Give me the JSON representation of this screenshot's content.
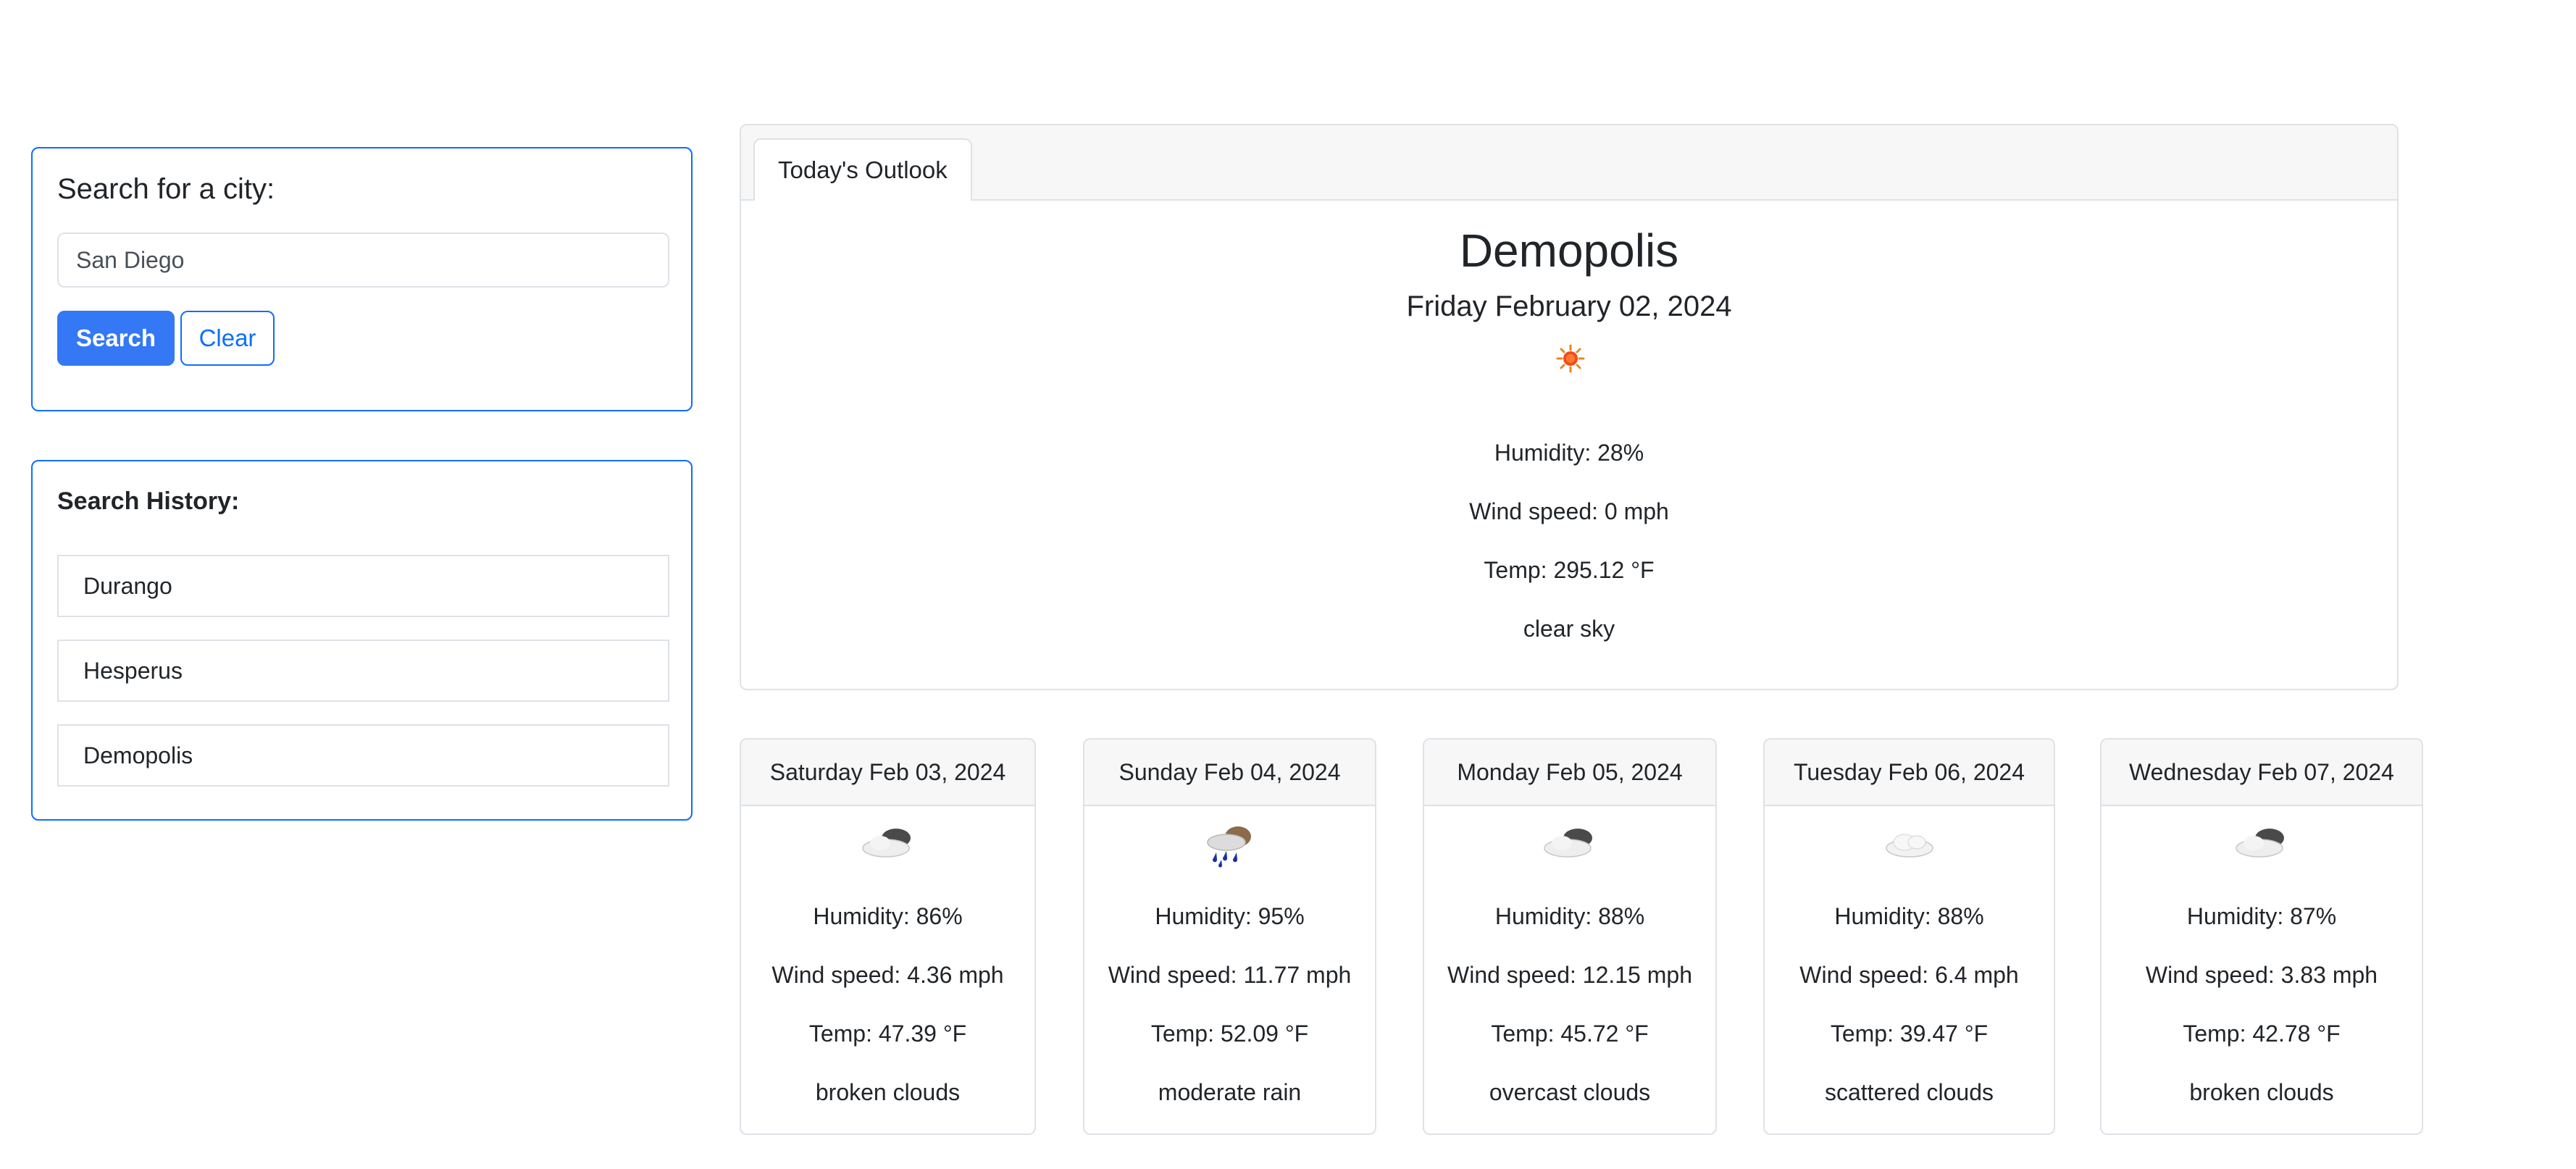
{
  "search": {
    "title": "Search for a city:",
    "input_value": "San Diego",
    "input_placeholder": "",
    "search_label": "Search",
    "clear_label": "Clear"
  },
  "history": {
    "title": "Search History:",
    "items": [
      "Durango",
      "Hesperus",
      "Demopolis"
    ]
  },
  "today": {
    "tab_label": "Today's Outlook",
    "city": "Demopolis",
    "date": "Friday February 02, 2024",
    "icon": "sun-icon",
    "humidity": "Humidity: 28%",
    "wind": "Wind speed: 0 mph",
    "temp": "Temp: 295.12 °F",
    "description": "clear sky"
  },
  "forecast": [
    {
      "date": "Saturday Feb 03, 2024",
      "icon": "broken-clouds-icon",
      "humidity": "Humidity: 86%",
      "wind": "Wind speed: 4.36 mph",
      "temp": "Temp: 47.39 °F",
      "description": "broken clouds"
    },
    {
      "date": "Sunday Feb 04, 2024",
      "icon": "moderate-rain-icon",
      "humidity": "Humidity: 95%",
      "wind": "Wind speed: 11.77 mph",
      "temp": "Temp: 52.09 °F",
      "description": "moderate rain"
    },
    {
      "date": "Monday Feb 05, 2024",
      "icon": "overcast-clouds-icon",
      "humidity": "Humidity: 88%",
      "wind": "Wind speed: 12.15 mph",
      "temp": "Temp: 45.72 °F",
      "description": "overcast clouds"
    },
    {
      "date": "Tuesday Feb 06, 2024",
      "icon": "scattered-clouds-icon",
      "humidity": "Humidity: 88%",
      "wind": "Wind speed: 6.4 mph",
      "temp": "Temp: 39.47 °F",
      "description": "scattered clouds"
    },
    {
      "date": "Wednesday Feb 07, 2024",
      "icon": "broken-clouds-icon",
      "humidity": "Humidity: 87%",
      "wind": "Wind speed: 3.83 mph",
      "temp": "Temp: 42.78 °F",
      "description": "broken clouds"
    }
  ],
  "colors": {
    "primary": "#0d6efd",
    "button_fill": "#3478f6",
    "border": "#dee2e6",
    "header_bg": "#f7f7f7"
  }
}
